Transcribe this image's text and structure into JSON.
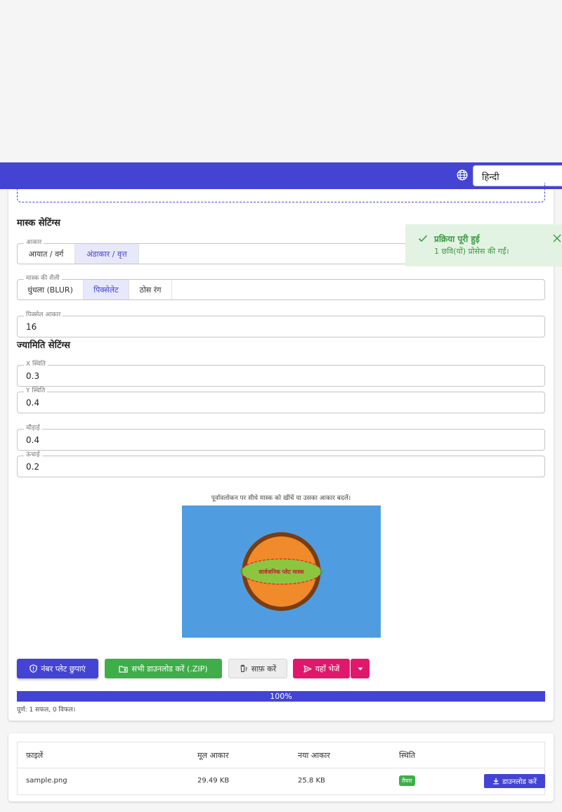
{
  "header": {
    "language": "हिन्दी",
    "globe_icon": "globe-icon"
  },
  "mask_settings": {
    "title": "मास्क सेटिंग्स",
    "shape": {
      "legend": "आकार",
      "options": [
        "आयात / वर्ग",
        "अंडाकार / वृत्त"
      ],
      "selected": "अंडाकार / वृत्त"
    },
    "style": {
      "legend": "मास्क की शैली",
      "options": [
        "धुंधला (BLUR)",
        "पिक्सेलेट",
        "ठोस रंग"
      ],
      "selected": "पिक्सेलेट"
    },
    "pixel_size": {
      "legend": "पिक्सेल आकार",
      "value": "16"
    }
  },
  "geometry_settings": {
    "title": "ज्यामिति सेटिंग्स",
    "x": {
      "legend": "X स्थिति",
      "value": "0.3"
    },
    "y": {
      "legend": "Y स्थिति",
      "value": "0.4"
    },
    "width": {
      "legend": "चौड़ाई",
      "value": "0.4"
    },
    "height": {
      "legend": "ऊंचाई",
      "value": "0.2"
    }
  },
  "preview": {
    "hint": "पूर्वावलोकन पर सीधे मास्क को खींचें या उसका आकार बदलें।",
    "plate_text": "सार्वजनिक प्लेट मास्क",
    "colors": {
      "background": "#4f9de0",
      "circle_outer": "#7a3d12",
      "circle_inner": "#f08a2a",
      "mask": "#8cc63f",
      "mask_border": "#d9262b"
    }
  },
  "actions": {
    "hide_plates": "नंबर प्लेट छुपाएं",
    "download_all": "सभी डाउनलोड करें (.ZIP)",
    "clear": "साफ़ करें",
    "send_here": "यहाँ भेजें"
  },
  "progress": {
    "percent": 100,
    "label": "100%",
    "summary": "पूर्ण: 1 सफल, 0 विफल।"
  },
  "toast": {
    "title": "प्रक्रिया पूरी हुई",
    "message": "1 छवि(यों) प्रोसेस की गईं।"
  },
  "table": {
    "headers": [
      "फ़ाइलें",
      "मूल आकार",
      "नया आकार",
      "स्थिति"
    ],
    "rows": [
      {
        "file": "sample.png",
        "original_size": "29.49 KB",
        "new_size": "25.8 KB",
        "status": "तैयार",
        "download": "डाउनलोड करें"
      }
    ]
  },
  "colors": {
    "primary": "#4444d4",
    "success": "#3fae4a",
    "accent": "#e0186c"
  }
}
